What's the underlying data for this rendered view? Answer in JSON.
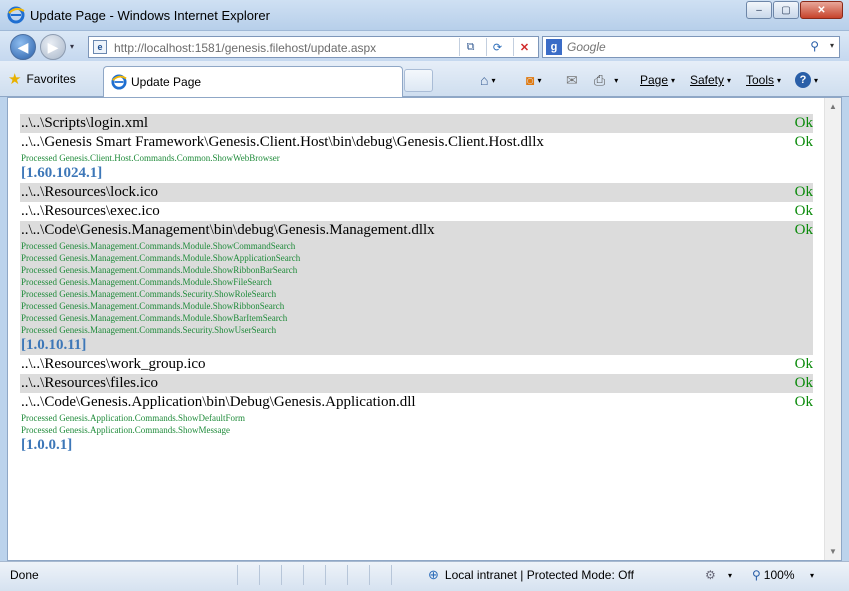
{
  "window": {
    "title": "Update Page - Windows Internet Explorer",
    "minimize": "‒",
    "maximize": "▢",
    "close": "✕"
  },
  "nav": {
    "back": "◀",
    "forward": "▶",
    "dropdown": "▾",
    "url": "http://localhost:1581/genesis.filehost/update.aspx",
    "compat": "⧉",
    "refresh": "⟳",
    "stop": "✕",
    "search_placeholder": "Google",
    "search_icon": "⚲"
  },
  "toolbar": {
    "favorites": "Favorites",
    "tab_title": "Update Page",
    "home": "⌂",
    "feeds": "◙",
    "mail": "✉",
    "print": "⎙",
    "page": "Page",
    "safety": "Safety",
    "tools": "Tools",
    "help": "?",
    "dropdown": "▾"
  },
  "files": [
    {
      "path": "..\\..\\Scripts\\login.xml",
      "status": "Ok",
      "shaded": true,
      "processed": [],
      "version": ""
    },
    {
      "path": "..\\..\\Genesis Smart Framework\\Genesis.Client.Host\\bin\\debug\\Genesis.Client.Host.dllx",
      "status": "Ok",
      "shaded": false,
      "processed": [
        "Processed Genesis.Client.Host.Commands.Common.ShowWebBrowser"
      ],
      "version": "[1.60.1024.1]"
    },
    {
      "path": "..\\..\\Resources\\lock.ico",
      "status": "Ok",
      "shaded": true,
      "processed": [],
      "version": ""
    },
    {
      "path": "..\\..\\Resources\\exec.ico",
      "status": "Ok",
      "shaded": false,
      "processed": [],
      "version": ""
    },
    {
      "path": "..\\..\\Code\\Genesis.Management\\bin\\debug\\Genesis.Management.dllx",
      "status": "Ok",
      "shaded": true,
      "processed": [
        "Processed Genesis.Management.Commands.Module.ShowCommandSearch",
        "Processed Genesis.Management.Commands.Module.ShowApplicationSearch",
        "Processed Genesis.Management.Commands.Module.ShowRibbonBarSearch",
        "Processed Genesis.Management.Commands.Module.ShowFileSearch",
        "Processed Genesis.Management.Commands.Security.ShowRoleSearch",
        "Processed Genesis.Management.Commands.Module.ShowRibbonSearch",
        "Processed Genesis.Management.Commands.Module.ShowBarItemSearch",
        "Processed Genesis.Management.Commands.Security.ShowUserSearch"
      ],
      "version": "[1.0.10.11]"
    },
    {
      "path": "..\\..\\Resources\\work_group.ico",
      "status": "Ok",
      "shaded": false,
      "processed": [],
      "version": ""
    },
    {
      "path": "..\\..\\Resources\\files.ico",
      "status": "Ok",
      "shaded": true,
      "processed": [],
      "version": ""
    },
    {
      "path": "..\\..\\Code\\Genesis.Application\\bin\\Debug\\Genesis.Application.dll",
      "status": "Ok",
      "shaded": false,
      "processed": [
        "Processed Genesis.Application.Commands.ShowDefaultForm",
        "Processed Genesis.Application.Commands.ShowMessage"
      ],
      "version": "[1.0.0.1]"
    }
  ],
  "statusbar": {
    "text": "Done",
    "zone": "Local intranet | Protected Mode: Off",
    "zone_icon": "⊕",
    "zoom": "100%",
    "zoom_icon": "⚲",
    "dropdown": "▾"
  },
  "colors": {
    "ok": "#0a8a0a",
    "processed": "#1f8b3a",
    "version": "#3d77b8",
    "shade": "#dcdcdc"
  }
}
